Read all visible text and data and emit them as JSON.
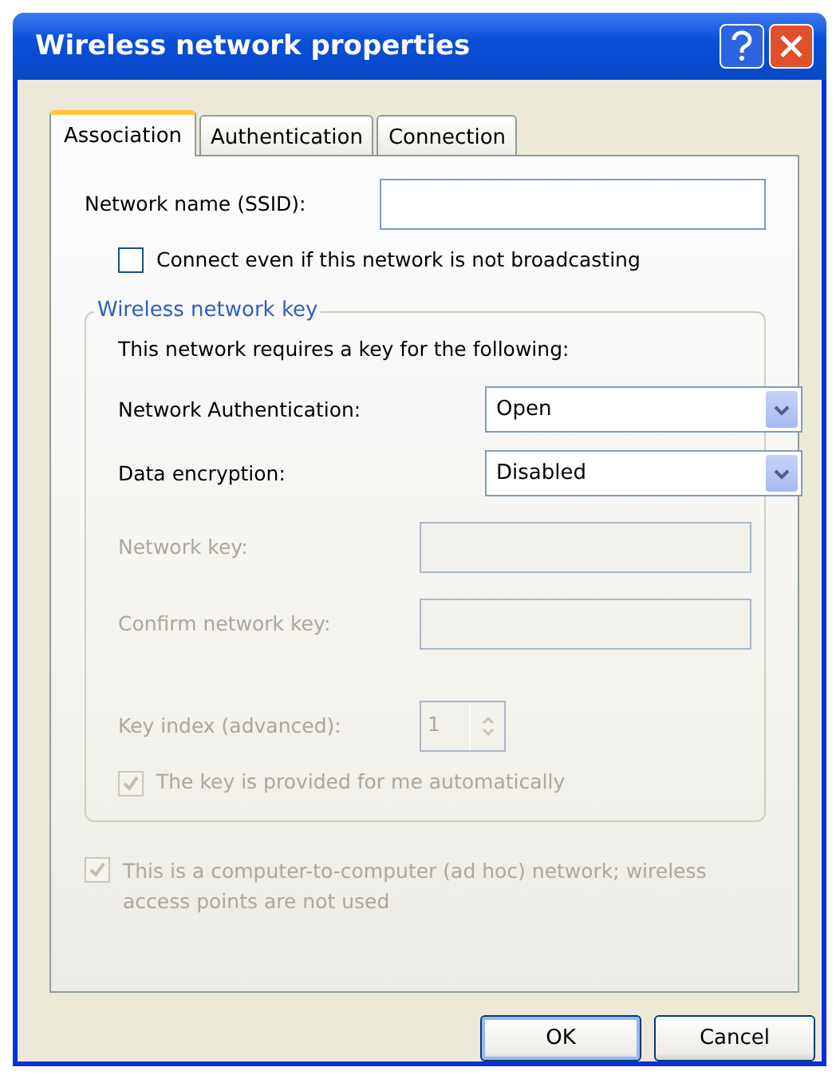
{
  "window": {
    "title": "Wireless network properties"
  },
  "tabs": [
    {
      "label": "Association",
      "selected": true
    },
    {
      "label": "Authentication",
      "selected": false
    },
    {
      "label": "Connection",
      "selected": false
    }
  ],
  "ssid": {
    "label": "Network name (SSID):",
    "disabled": false
  },
  "broadcast_checkbox": {
    "label": "Connect even if this network is not broadcasting",
    "checked": false,
    "disabled": false
  },
  "key_group": {
    "title": "Wireless network key",
    "intro": "This network requires a key for the following:",
    "rows": [
      {
        "kind": "dropdown",
        "label": "Network Authentication:",
        "value": "Open",
        "disabled": false
      },
      {
        "kind": "dropdown",
        "label": "Data encryption:",
        "value": "Disabled",
        "disabled": false
      },
      {
        "kind": "text",
        "label": "Network key:",
        "disabled": true
      },
      {
        "kind": "text",
        "label": "Confirm network key:",
        "disabled": true
      },
      {
        "kind": "spinner",
        "label": "Key index (advanced):",
        "value": "1",
        "disabled": true
      }
    ],
    "auto_key": {
      "label": "The key is provided for me automatically",
      "checked": true,
      "disabled": true
    }
  },
  "adhoc_checkbox": {
    "label": "This is a computer-to-computer (ad hoc) network; wireless access points are not used",
    "checked": true,
    "disabled": true
  },
  "buttons": [
    {
      "label": "OK",
      "default": true
    },
    {
      "label": "Cancel",
      "default": false
    }
  ]
}
